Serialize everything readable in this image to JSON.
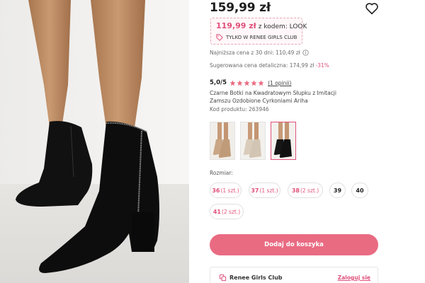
{
  "product": {
    "price": "159,99 zł",
    "promo": {
      "code_price": "119,99 zł",
      "code_text": "z kodem: LOOK",
      "club_tag": "TYLKO W RENEE GIRLS CLUB"
    },
    "lowest_price_text": "Najniższa cena z 30 dni: 110,49 zł",
    "retail_price_text": "Sugerowana cena detaliczna: 174,99 zł",
    "retail_discount": "-31%",
    "rating": {
      "score": "5,0/5",
      "stars": 5,
      "opinions_link": "(1 opinii)"
    },
    "name": "Czarne Botki na Kwadratowym Słupku z Imitacji Zamszu Ozdobione Cyrkoniami Ariha",
    "code_text": "Kod produktu: 263946"
  },
  "icons": {
    "favorite": "heart-icon",
    "tag": "tag-icon",
    "info": "info-icon",
    "star": "star-icon",
    "club": "club-icon"
  },
  "colors": {
    "accent": "#e0517a",
    "button": "#e96b82",
    "star": "#e96b82"
  },
  "thumbnails": [
    {
      "name": "thumb-beige-boots",
      "active": false
    },
    {
      "name": "thumb-light-boots",
      "active": false
    },
    {
      "name": "thumb-black-boots",
      "active": true
    }
  ],
  "sizes": {
    "label": "Rozmiar:",
    "options": [
      {
        "size": "36",
        "qty": "(1 szt.)"
      },
      {
        "size": "37",
        "qty": "(1 szt.)"
      },
      {
        "size": "38",
        "qty": "(2 szt.)"
      },
      {
        "size": "39",
        "qty": ""
      },
      {
        "size": "40",
        "qty": ""
      },
      {
        "size": "41",
        "qty": "(2 szt.)"
      }
    ]
  },
  "cart": {
    "add_label": "Dodaj do koszyka"
  },
  "club": {
    "name": "Renee Girls Club",
    "login_label": "Zaloguj się"
  }
}
